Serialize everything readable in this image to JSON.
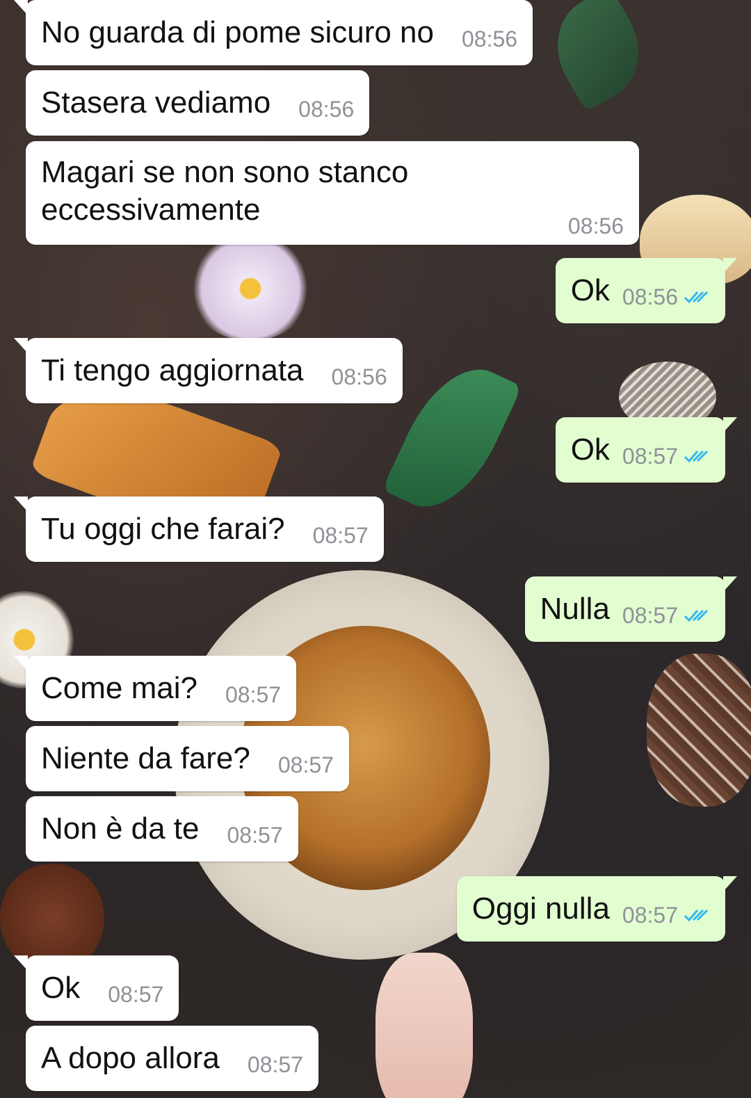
{
  "theme": {
    "incoming_bg": "#ffffff",
    "outgoing_bg": "#e2fdd0",
    "tick_color": "#34b7f1"
  },
  "messages": [
    {
      "dir": "in",
      "text": "No guarda di pome sicuro no",
      "time": "08:56"
    },
    {
      "dir": "in",
      "text": "Stasera vediamo",
      "time": "08:56"
    },
    {
      "dir": "in",
      "text": "Magari se non sono stanco eccessivamente",
      "time": "08:56"
    },
    {
      "dir": "out",
      "text": "Ok",
      "time": "08:56",
      "status": "read"
    },
    {
      "dir": "in",
      "text": "Ti tengo aggiornata",
      "time": "08:56"
    },
    {
      "dir": "out",
      "text": "Ok",
      "time": "08:57",
      "status": "read"
    },
    {
      "dir": "in",
      "text": "Tu oggi che farai?",
      "time": "08:57"
    },
    {
      "dir": "out",
      "text": "Nulla",
      "time": "08:57",
      "status": "read"
    },
    {
      "dir": "in",
      "text": "Come mai?",
      "time": "08:57"
    },
    {
      "dir": "in",
      "text": "Niente da fare?",
      "time": "08:57"
    },
    {
      "dir": "in",
      "text": "Non è da te",
      "time": "08:57"
    },
    {
      "dir": "out",
      "text": "Oggi nulla",
      "time": "08:57",
      "status": "read"
    },
    {
      "dir": "in",
      "text": "Ok",
      "time": "08:57"
    },
    {
      "dir": "in",
      "text": "A dopo allora",
      "time": "08:57"
    }
  ]
}
